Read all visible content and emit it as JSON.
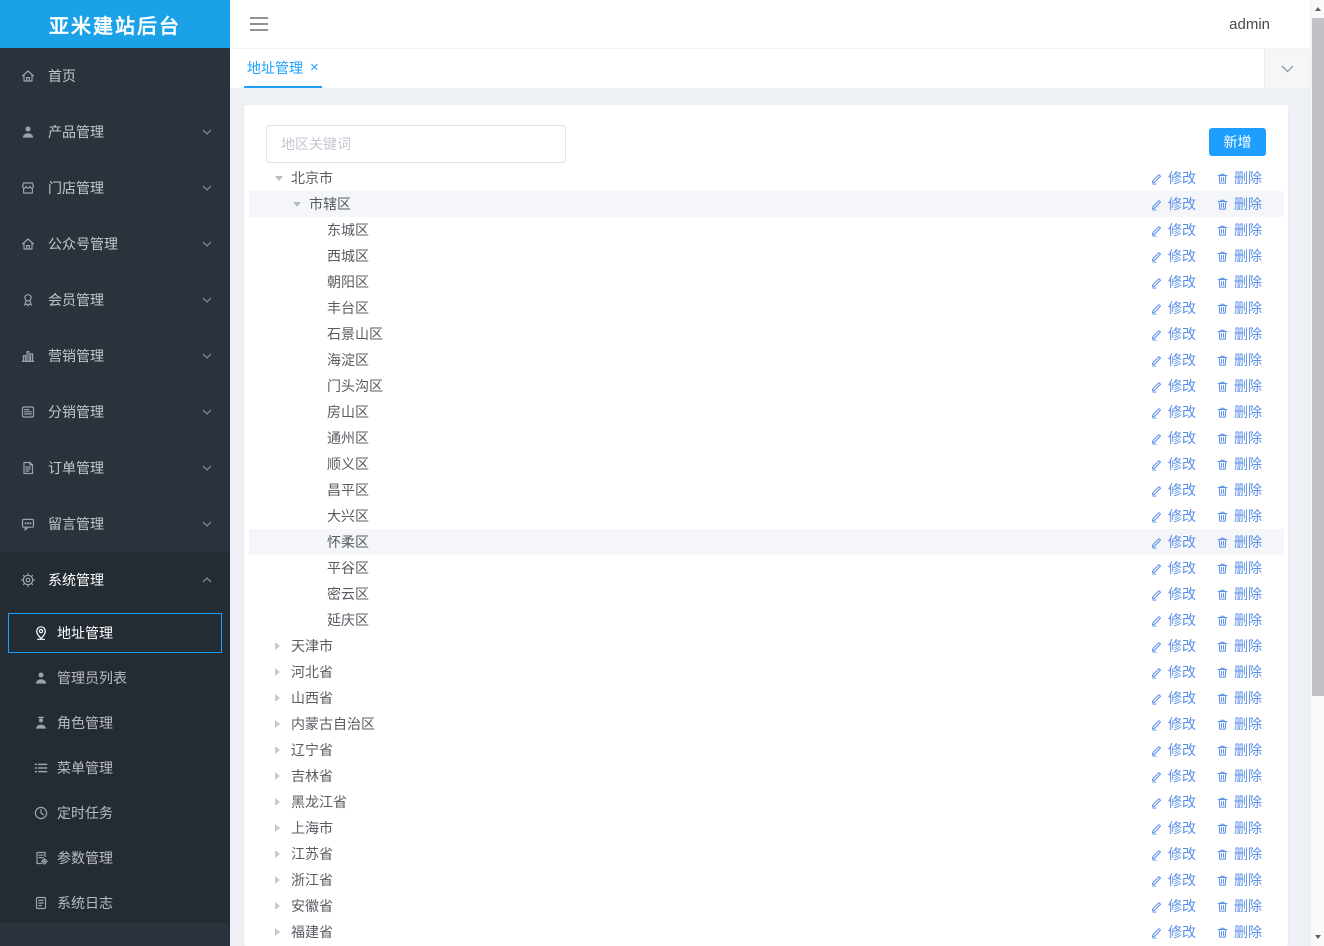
{
  "colors": {
    "brand_blue": "#1E9FFF",
    "logo_bg": "#1AA1E8",
    "sidebar_bg": "#2A333C",
    "sidebar_expanded_bg": "#232B33",
    "content_bg": "#EDF0F4",
    "action_link_blue": "#5A8FE8",
    "row_highlight": "#F4F6FA"
  },
  "sidebar": {
    "logo": "亚米建站后台",
    "items": [
      {
        "label": "首页",
        "icon": "home",
        "arrow": null
      },
      {
        "label": "产品管理",
        "icon": "user",
        "arrow": "down"
      },
      {
        "label": "门店管理",
        "icon": "store",
        "arrow": "down"
      },
      {
        "label": "公众号管理",
        "icon": "official",
        "arrow": "down"
      },
      {
        "label": "会员管理",
        "icon": "member",
        "arrow": "down"
      },
      {
        "label": "营销管理",
        "icon": "chart",
        "arrow": "down"
      },
      {
        "label": "分销管理",
        "icon": "card",
        "arrow": "down"
      },
      {
        "label": "订单管理",
        "icon": "order",
        "arrow": "down"
      },
      {
        "label": "留言管理",
        "icon": "message",
        "arrow": "down"
      },
      {
        "label": "系统管理",
        "icon": "gear",
        "arrow": "up",
        "expanded": true,
        "children": [
          {
            "label": "地址管理",
            "icon": "pin",
            "selected": true
          },
          {
            "label": "管理员列表",
            "icon": "admin"
          },
          {
            "label": "角色管理",
            "icon": "role"
          },
          {
            "label": "菜单管理",
            "icon": "menu-list"
          },
          {
            "label": "定时任务",
            "icon": "clock"
          },
          {
            "label": "参数管理",
            "icon": "param"
          },
          {
            "label": "系统日志",
            "icon": "log"
          }
        ]
      }
    ]
  },
  "header": {
    "username": "admin"
  },
  "tabbar": {
    "tabs": [
      {
        "label": "地址管理",
        "active": true,
        "close_glyph": "×"
      }
    ]
  },
  "toolbar": {
    "search_placeholder": "地区关键词",
    "add_button_label": "新增"
  },
  "tree": {
    "edit_label": "修改",
    "delete_label": "删除",
    "rows": [
      {
        "label": "北京市",
        "level": 0,
        "state": "expanded",
        "highlighted": false
      },
      {
        "label": "市辖区",
        "level": 1,
        "state": "expanded",
        "highlighted": true
      },
      {
        "label": "东城区",
        "level": 2,
        "state": "leaf",
        "highlighted": false
      },
      {
        "label": "西城区",
        "level": 2,
        "state": "leaf",
        "highlighted": false
      },
      {
        "label": "朝阳区",
        "level": 2,
        "state": "leaf",
        "highlighted": false
      },
      {
        "label": "丰台区",
        "level": 2,
        "state": "leaf",
        "highlighted": false
      },
      {
        "label": "石景山区",
        "level": 2,
        "state": "leaf",
        "highlighted": false
      },
      {
        "label": "海淀区",
        "level": 2,
        "state": "leaf",
        "highlighted": false
      },
      {
        "label": "门头沟区",
        "level": 2,
        "state": "leaf",
        "highlighted": false
      },
      {
        "label": "房山区",
        "level": 2,
        "state": "leaf",
        "highlighted": false
      },
      {
        "label": "通州区",
        "level": 2,
        "state": "leaf",
        "highlighted": false
      },
      {
        "label": "顺义区",
        "level": 2,
        "state": "leaf",
        "highlighted": false
      },
      {
        "label": "昌平区",
        "level": 2,
        "state": "leaf",
        "highlighted": false
      },
      {
        "label": "大兴区",
        "level": 2,
        "state": "leaf",
        "highlighted": false
      },
      {
        "label": "怀柔区",
        "level": 2,
        "state": "leaf",
        "highlighted": true
      },
      {
        "label": "平谷区",
        "level": 2,
        "state": "leaf",
        "highlighted": false
      },
      {
        "label": "密云区",
        "level": 2,
        "state": "leaf",
        "highlighted": false
      },
      {
        "label": "延庆区",
        "level": 2,
        "state": "leaf",
        "highlighted": false
      },
      {
        "label": "天津市",
        "level": 0,
        "state": "collapsed",
        "highlighted": false
      },
      {
        "label": "河北省",
        "level": 0,
        "state": "collapsed",
        "highlighted": false
      },
      {
        "label": "山西省",
        "level": 0,
        "state": "collapsed",
        "highlighted": false
      },
      {
        "label": "内蒙古自治区",
        "level": 0,
        "state": "collapsed",
        "highlighted": false
      },
      {
        "label": "辽宁省",
        "level": 0,
        "state": "collapsed",
        "highlighted": false
      },
      {
        "label": "吉林省",
        "level": 0,
        "state": "collapsed",
        "highlighted": false
      },
      {
        "label": "黑龙江省",
        "level": 0,
        "state": "collapsed",
        "highlighted": false
      },
      {
        "label": "上海市",
        "level": 0,
        "state": "collapsed",
        "highlighted": false
      },
      {
        "label": "江苏省",
        "level": 0,
        "state": "collapsed",
        "highlighted": false
      },
      {
        "label": "浙江省",
        "level": 0,
        "state": "collapsed",
        "highlighted": false
      },
      {
        "label": "安徽省",
        "level": 0,
        "state": "collapsed",
        "highlighted": false
      },
      {
        "label": "福建省",
        "level": 0,
        "state": "collapsed",
        "highlighted": false
      }
    ]
  }
}
